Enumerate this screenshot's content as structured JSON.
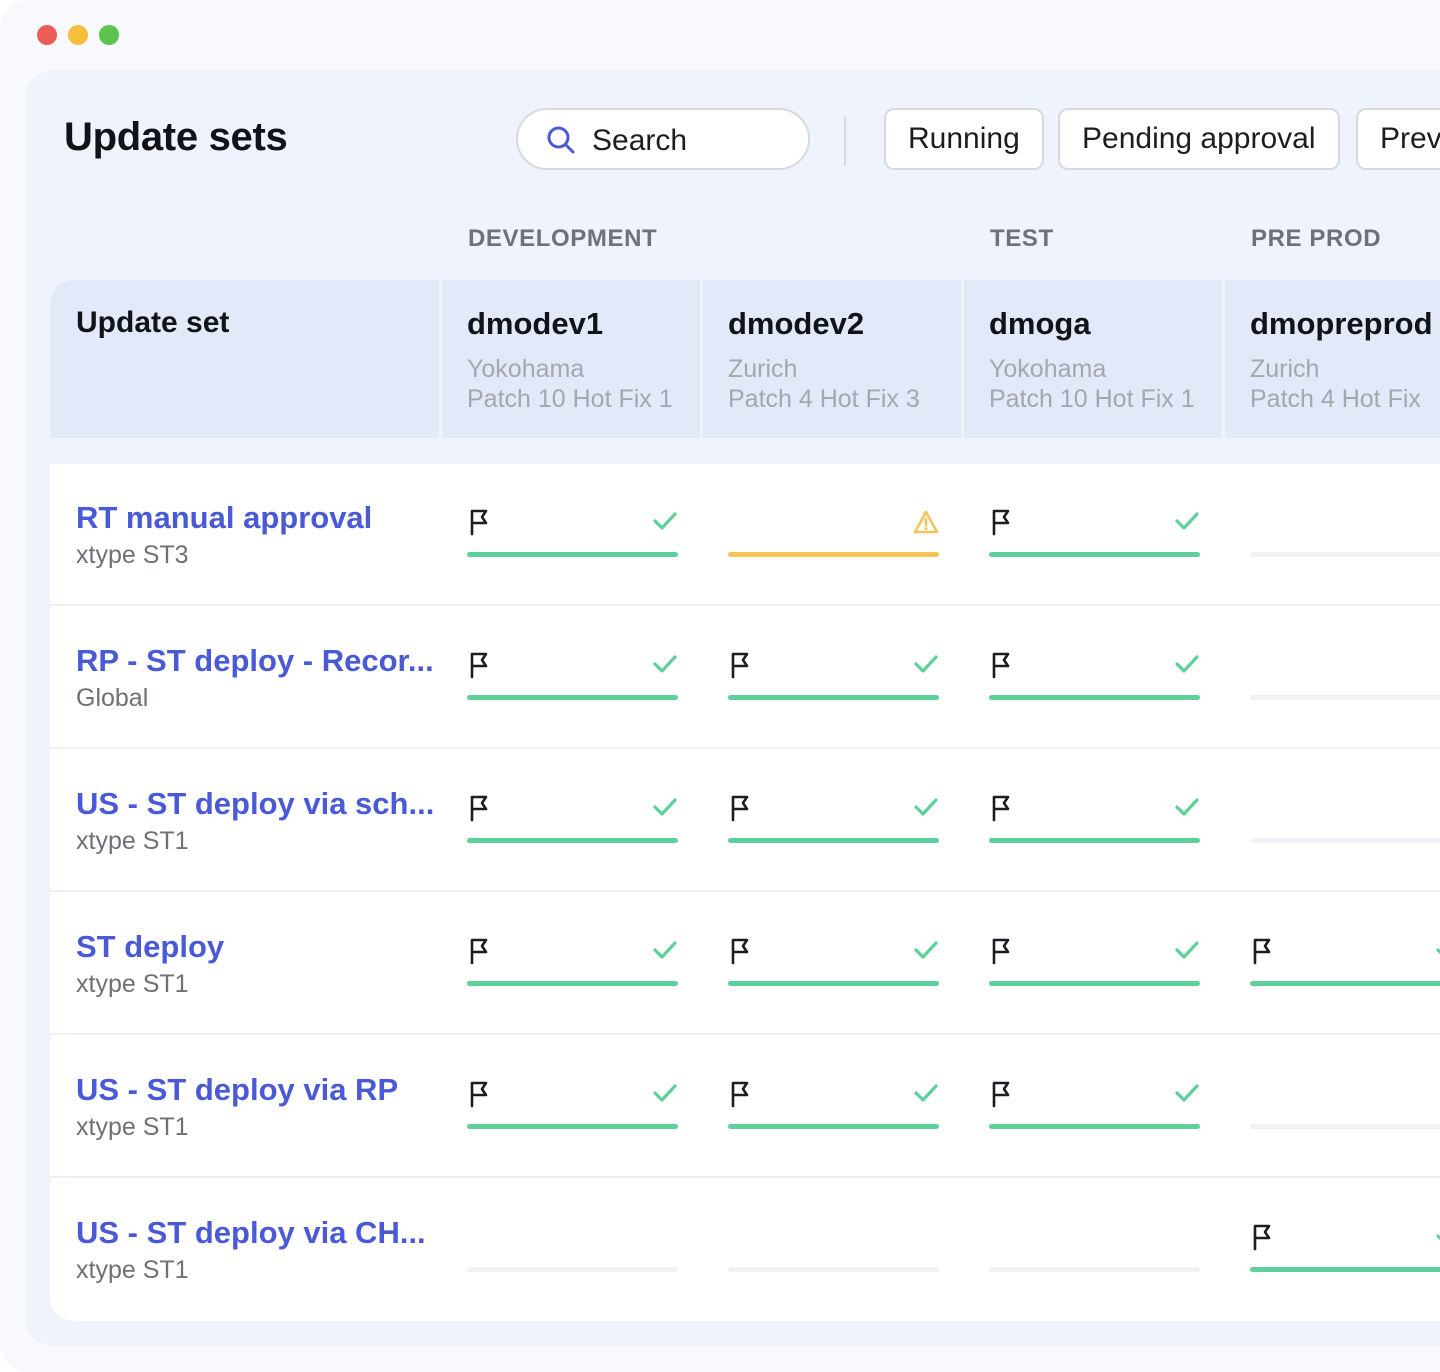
{
  "window": {
    "controls": [
      {
        "name": "close",
        "color": "#ec5e55"
      },
      {
        "name": "minimize",
        "color": "#f5be3d"
      },
      {
        "name": "maximize",
        "color": "#5cc44d"
      }
    ]
  },
  "header": {
    "title": "Update sets",
    "search": {
      "label": "Search",
      "icon": "search-icon"
    },
    "filters": [
      "Running",
      "Pending approval",
      "Prev"
    ]
  },
  "environments": [
    {
      "label": "DEVELOPMENT"
    },
    {
      "label": "TEST"
    },
    {
      "label": "PRE PROD"
    }
  ],
  "table": {
    "first_column_label": "Update set",
    "instances": [
      {
        "name": "dmodev1",
        "release": "Yokohama",
        "patch": "Patch 10 Hot Fix 1"
      },
      {
        "name": "dmodev2",
        "release": "Zurich",
        "patch": "Patch 4 Hot Fix 3"
      },
      {
        "name": "dmoga",
        "release": "Yokohama",
        "patch": "Patch 10 Hot Fix 1"
      },
      {
        "name": "dmopreprod",
        "release": "Zurich",
        "patch": "Patch 4 Hot Fix"
      }
    ],
    "rows": [
      {
        "title": "RT manual approval",
        "scope": "xtype ST3",
        "cells": [
          "success",
          "warning",
          "success",
          "empty"
        ]
      },
      {
        "title": "RP - ST deploy - Recor...",
        "scope": "Global",
        "cells": [
          "success",
          "success",
          "success",
          "empty"
        ]
      },
      {
        "title": "US - ST deploy via sch...",
        "scope": "xtype ST1",
        "cells": [
          "success",
          "success",
          "success",
          "empty"
        ]
      },
      {
        "title": "ST deploy",
        "scope": "xtype ST1",
        "cells": [
          "success",
          "success",
          "success",
          "success"
        ]
      },
      {
        "title": "US - ST deploy via RP",
        "scope": "xtype ST1",
        "cells": [
          "success",
          "success",
          "success",
          "empty"
        ]
      },
      {
        "title": "US - ST deploy via CH...",
        "scope": "xtype ST1",
        "cells": [
          "empty",
          "empty",
          "empty",
          "success"
        ]
      }
    ]
  },
  "status_colors": {
    "success": "#5ed09a",
    "warning": "#f5c35a",
    "empty": "#f1f2f5"
  },
  "icons": {
    "flag": "flag-icon",
    "success": "check-icon",
    "warning": "warning-triangle-icon"
  }
}
